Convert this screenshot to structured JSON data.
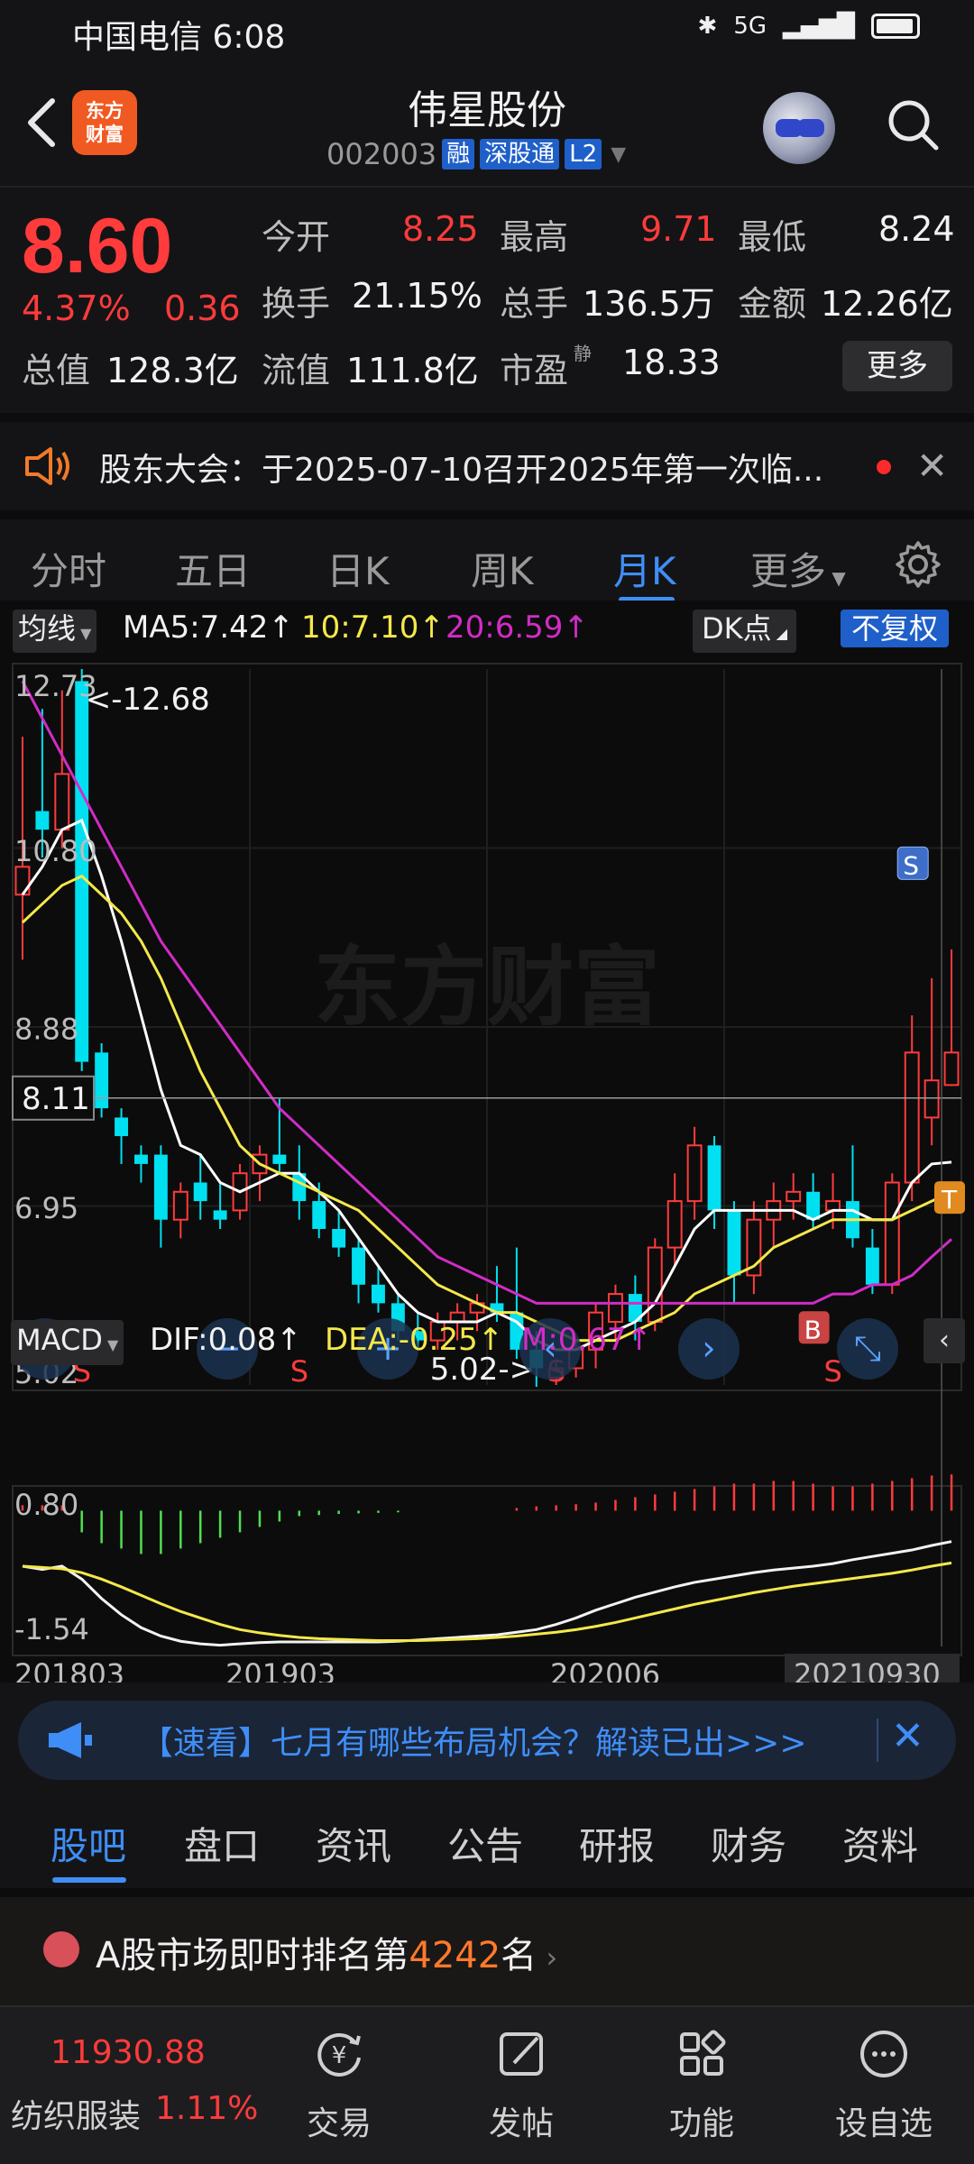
{
  "status_bar": {
    "carrier_time": "中国电信 6:08",
    "right_text": "5G"
  },
  "header": {
    "logo_text": "东方\n财富",
    "stock_name": "伟星股份",
    "stock_code": "002003",
    "tags": [
      "融",
      "深股通",
      "L2"
    ]
  },
  "quote": {
    "price": "8.60",
    "change_pct": "4.37%",
    "change_abs": "0.36",
    "rows": [
      [
        {
          "label": "今开",
          "value": "8.25",
          "color": "red"
        },
        {
          "label": "最高",
          "value": "9.71",
          "color": "red"
        },
        {
          "label": "最低",
          "value": "8.24",
          "color": "white"
        }
      ],
      [
        {
          "label": "换手",
          "value": "21.15%",
          "color": "white"
        },
        {
          "label": "总手",
          "value": "136.5万",
          "color": "white"
        },
        {
          "label": "金额",
          "value": "12.26亿",
          "color": "white"
        }
      ],
      [
        {
          "label": "总值",
          "value": "128.3亿",
          "color": "white"
        },
        {
          "label": "流值",
          "value": "111.8亿",
          "color": "white"
        },
        {
          "label": "市盈",
          "value": "18.33",
          "color": "white",
          "sup": "静"
        }
      ]
    ],
    "more_label": "更多"
  },
  "notice": {
    "text": "股东大会：于2025-07-10召开2025年第一次临..."
  },
  "period_tabs": [
    "分时",
    "五日",
    "日K",
    "周K",
    "月K",
    "更多"
  ],
  "active_period": "月K",
  "chart": {
    "ma_mode": "均线",
    "ma5": "MA5:7.42↑",
    "ma10": "10:7.10↑",
    "ma20": "20:6.59↑",
    "dk_label": "DK点",
    "adjust_label": "不复权",
    "watermark": "东方财富",
    "y_labels": [
      "12.73",
      "10.80",
      "8.88",
      "6.95",
      "5.02"
    ],
    "crosshair_price": "8.11",
    "high_marker": "<-12.68",
    "low_marker": "5.02->",
    "macd_mode": "MACD",
    "dif": "DIF:0.08↑",
    "dea": "DEA:-0.25↑",
    "m": "M:0.67↑",
    "macd_y_labels": [
      "0.80",
      "-1.54"
    ],
    "x_labels": [
      "201803",
      "201903",
      "202006",
      "20210930"
    ],
    "marks": {
      "s": "S",
      "b": "B",
      "t": "T"
    }
  },
  "chart_data": {
    "type": "candlestick",
    "title": "伟星股份 月K",
    "ylim": [
      5.02,
      12.73
    ],
    "candles": [
      {
        "o": 10.3,
        "h": 12.0,
        "l": 9.6,
        "c": 10.6
      },
      {
        "o": 11.2,
        "h": 12.3,
        "l": 10.7,
        "c": 11.0
      },
      {
        "o": 11.0,
        "h": 12.5,
        "l": 10.8,
        "c": 11.6
      },
      {
        "o": 12.6,
        "h": 12.73,
        "l": 8.4,
        "c": 8.5
      },
      {
        "o": 8.6,
        "h": 8.7,
        "l": 7.9,
        "c": 8.0
      },
      {
        "o": 7.9,
        "h": 8.0,
        "l": 7.4,
        "c": 7.7
      },
      {
        "o": 7.5,
        "h": 7.6,
        "l": 7.2,
        "c": 7.4
      },
      {
        "o": 7.5,
        "h": 7.6,
        "l": 6.5,
        "c": 6.8
      },
      {
        "o": 6.8,
        "h": 7.2,
        "l": 6.6,
        "c": 7.1
      },
      {
        "o": 7.2,
        "h": 7.5,
        "l": 6.8,
        "c": 7.0
      },
      {
        "o": 6.9,
        "h": 7.2,
        "l": 6.7,
        "c": 6.8
      },
      {
        "o": 6.9,
        "h": 7.4,
        "l": 6.8,
        "c": 7.3
      },
      {
        "o": 7.3,
        "h": 7.6,
        "l": 7.0,
        "c": 7.5
      },
      {
        "o": 7.5,
        "h": 8.1,
        "l": 7.3,
        "c": 7.4
      },
      {
        "o": 7.3,
        "h": 7.6,
        "l": 6.8,
        "c": 7.0
      },
      {
        "o": 7.0,
        "h": 7.2,
        "l": 6.6,
        "c": 6.7
      },
      {
        "o": 6.7,
        "h": 6.9,
        "l": 6.4,
        "c": 6.5
      },
      {
        "o": 6.5,
        "h": 6.6,
        "l": 5.9,
        "c": 6.1
      },
      {
        "o": 6.1,
        "h": 6.3,
        "l": 5.8,
        "c": 5.9
      },
      {
        "o": 5.9,
        "h": 6.0,
        "l": 5.5,
        "c": 5.6
      },
      {
        "o": 5.6,
        "h": 5.8,
        "l": 5.4,
        "c": 5.5
      },
      {
        "o": 5.5,
        "h": 5.8,
        "l": 5.4,
        "c": 5.7
      },
      {
        "o": 5.7,
        "h": 5.9,
        "l": 5.5,
        "c": 5.8
      },
      {
        "o": 5.8,
        "h": 6.0,
        "l": 5.6,
        "c": 5.9
      },
      {
        "o": 5.9,
        "h": 6.3,
        "l": 5.7,
        "c": 5.8
      },
      {
        "o": 5.8,
        "h": 6.5,
        "l": 5.3,
        "c": 5.4
      },
      {
        "o": 5.4,
        "h": 5.6,
        "l": 5.0,
        "c": 5.2
      },
      {
        "o": 5.1,
        "h": 5.3,
        "l": 5.02,
        "c": 5.2
      },
      {
        "o": 5.2,
        "h": 5.5,
        "l": 5.1,
        "c": 5.4
      },
      {
        "o": 5.4,
        "h": 5.9,
        "l": 5.2,
        "c": 5.8
      },
      {
        "o": 5.7,
        "h": 6.1,
        "l": 5.5,
        "c": 6.0
      },
      {
        "o": 6.0,
        "h": 6.2,
        "l": 5.5,
        "c": 5.7
      },
      {
        "o": 5.7,
        "h": 6.6,
        "l": 5.6,
        "c": 6.5
      },
      {
        "o": 6.5,
        "h": 7.3,
        "l": 6.3,
        "c": 7.0
      },
      {
        "o": 7.0,
        "h": 7.8,
        "l": 6.8,
        "c": 7.6
      },
      {
        "o": 7.6,
        "h": 7.7,
        "l": 6.7,
        "c": 6.9
      },
      {
        "o": 6.9,
        "h": 7.0,
        "l": 5.9,
        "c": 6.2
      },
      {
        "o": 6.2,
        "h": 7.0,
        "l": 6.0,
        "c": 6.8
      },
      {
        "o": 6.8,
        "h": 7.2,
        "l": 6.5,
        "c": 7.0
      },
      {
        "o": 7.0,
        "h": 7.3,
        "l": 6.8,
        "c": 7.1
      },
      {
        "o": 7.1,
        "h": 7.3,
        "l": 6.7,
        "c": 6.8
      },
      {
        "o": 6.9,
        "h": 7.3,
        "l": 6.7,
        "c": 7.0
      },
      {
        "o": 7.0,
        "h": 7.6,
        "l": 6.5,
        "c": 6.6
      },
      {
        "o": 6.5,
        "h": 6.7,
        "l": 6.0,
        "c": 6.1
      },
      {
        "o": 6.1,
        "h": 7.3,
        "l": 6.0,
        "c": 7.2
      },
      {
        "o": 7.2,
        "h": 9.0,
        "l": 7.0,
        "c": 8.6
      },
      {
        "o": 7.9,
        "h": 9.4,
        "l": 7.6,
        "c": 8.3
      },
      {
        "o": 8.25,
        "h": 9.71,
        "l": 8.24,
        "c": 8.6
      }
    ],
    "series": [
      {
        "name": "MA5",
        "color": "#ffffff",
        "values": [
          10.3,
          10.6,
          11.0,
          11.1,
          10.5,
          9.8,
          9.0,
          8.2,
          7.6,
          7.5,
          7.2,
          7.1,
          7.2,
          7.3,
          7.3,
          7.1,
          6.9,
          6.6,
          6.3,
          6.0,
          5.8,
          5.7,
          5.7,
          5.7,
          5.8,
          5.7,
          5.5,
          5.4,
          5.4,
          5.5,
          5.6,
          5.7,
          5.9,
          6.3,
          6.7,
          6.9,
          6.9,
          6.9,
          6.9,
          6.9,
          6.8,
          6.9,
          6.9,
          6.8,
          6.8,
          7.2,
          7.4,
          7.42
        ]
      },
      {
        "name": "MA10",
        "color": "#f4e84a",
        "values": [
          10.0,
          10.2,
          10.4,
          10.5,
          10.3,
          10.1,
          9.8,
          9.4,
          8.9,
          8.4,
          8.0,
          7.6,
          7.4,
          7.3,
          7.2,
          7.1,
          7.0,
          6.9,
          6.7,
          6.5,
          6.3,
          6.1,
          6.0,
          5.9,
          5.8,
          5.8,
          5.7,
          5.6,
          5.5,
          5.5,
          5.5,
          5.6,
          5.7,
          5.8,
          6.0,
          6.1,
          6.2,
          6.3,
          6.5,
          6.6,
          6.7,
          6.8,
          6.8,
          6.8,
          6.8,
          6.9,
          7.0,
          7.1
        ]
      },
      {
        "name": "MA20",
        "color": "#d22cc6",
        "values": [
          12.6,
          12.2,
          11.8,
          11.4,
          11.0,
          10.6,
          10.2,
          9.8,
          9.5,
          9.2,
          8.9,
          8.6,
          8.3,
          8.0,
          7.8,
          7.6,
          7.4,
          7.2,
          7.0,
          6.8,
          6.6,
          6.4,
          6.3,
          6.2,
          6.1,
          6.0,
          5.9,
          5.9,
          5.9,
          5.9,
          5.9,
          5.9,
          5.9,
          5.9,
          5.9,
          5.9,
          5.9,
          5.9,
          5.9,
          5.9,
          5.9,
          6.0,
          6.0,
          6.1,
          6.1,
          6.2,
          6.4,
          6.59
        ]
      }
    ],
    "macd": {
      "ylim": [
        -1.54,
        0.8
      ],
      "hist": [
        0.1,
        0.1,
        0.1,
        -0.4,
        -0.6,
        -0.7,
        -0.8,
        -0.8,
        -0.7,
        -0.6,
        -0.5,
        -0.4,
        -0.3,
        -0.2,
        -0.1,
        -0.08,
        -0.06,
        -0.05,
        -0.04,
        -0.03,
        0.0,
        0.0,
        0.0,
        0.0,
        0.0,
        0.05,
        0.08,
        0.1,
        0.12,
        0.15,
        0.2,
        0.25,
        0.3,
        0.35,
        0.4,
        0.45,
        0.5,
        0.5,
        0.55,
        0.55,
        0.5,
        0.45,
        0.45,
        0.5,
        0.55,
        0.6,
        0.65,
        0.67
      ],
      "dif": [
        -0.3,
        -0.35,
        -0.3,
        -0.5,
        -0.8,
        -1.05,
        -1.25,
        -1.38,
        -1.46,
        -1.5,
        -1.52,
        -1.5,
        -1.48,
        -1.47,
        -1.47,
        -1.47,
        -1.47,
        -1.47,
        -1.47,
        -1.46,
        -1.44,
        -1.42,
        -1.4,
        -1.38,
        -1.36,
        -1.32,
        -1.28,
        -1.2,
        -1.1,
        -0.98,
        -0.88,
        -0.78,
        -0.7,
        -0.62,
        -0.55,
        -0.5,
        -0.45,
        -0.4,
        -0.36,
        -0.33,
        -0.3,
        -0.26,
        -0.2,
        -0.15,
        -0.1,
        -0.05,
        0.02,
        0.08
      ],
      "dea": [
        -0.3,
        -0.32,
        -0.34,
        -0.4,
        -0.5,
        -0.62,
        -0.75,
        -0.88,
        -1.0,
        -1.1,
        -1.2,
        -1.28,
        -1.33,
        -1.37,
        -1.4,
        -1.42,
        -1.43,
        -1.44,
        -1.45,
        -1.45,
        -1.45,
        -1.44,
        -1.43,
        -1.42,
        -1.4,
        -1.38,
        -1.35,
        -1.32,
        -1.28,
        -1.23,
        -1.17,
        -1.1,
        -1.03,
        -0.96,
        -0.89,
        -0.83,
        -0.77,
        -0.71,
        -0.66,
        -0.61,
        -0.57,
        -0.53,
        -0.49,
        -0.45,
        -0.41,
        -0.36,
        -0.3,
        -0.25
      ]
    },
    "x_ticks": [
      "201803",
      "201903",
      "202006",
      "20210930"
    ]
  },
  "banner": {
    "text": "【速看】七月有哪些布局机会？解读已出>>>"
  },
  "info_tabs": [
    "股吧",
    "盘口",
    "资讯",
    "公告",
    "研报",
    "财务",
    "资料"
  ],
  "active_info_tab": "股吧",
  "rank": {
    "prefix": "A股市场即时排名第",
    "number": "4242",
    "suffix": "名"
  },
  "bottom_nav": {
    "index_value": "11930.88",
    "sector_name": "纺织服装",
    "sector_pct": "1.11%",
    "items": [
      {
        "label": "交易",
        "icon": "yuan-refresh-icon"
      },
      {
        "label": "发帖",
        "icon": "edit-icon"
      },
      {
        "label": "功能",
        "icon": "grid-icon"
      },
      {
        "label": "设自选",
        "icon": "more-circle-icon"
      }
    ]
  },
  "colors": {
    "up": "#ff3b3b",
    "down": "#00e0f0",
    "accent": "#3f8ef7"
  }
}
